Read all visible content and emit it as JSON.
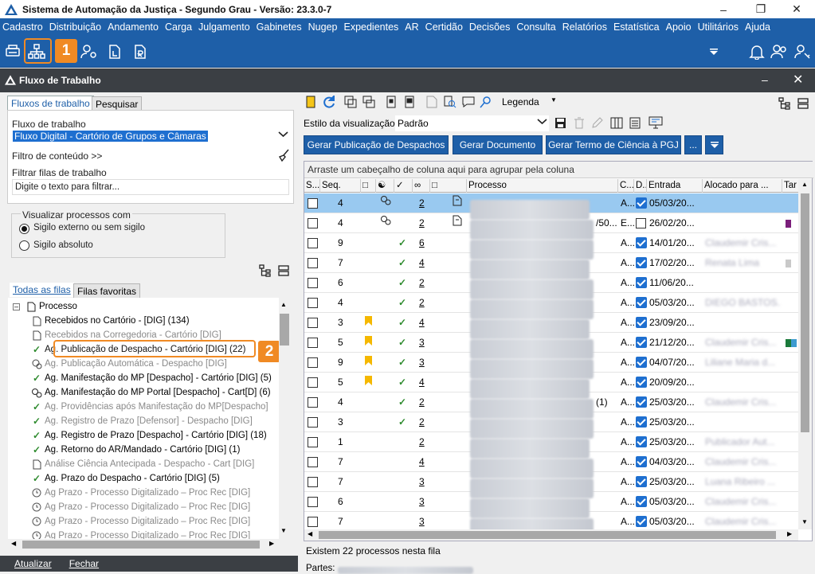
{
  "window": {
    "title": "Sistema de Automação da Justiça - Segundo Grau - Versão: 23.3.0-7"
  },
  "menu": [
    "Cadastro",
    "Distribuição",
    "Andamento",
    "Carga",
    "Julgamento",
    "Gabinetes",
    "Nugep",
    "Expedientes",
    "AR",
    "Certidão",
    "Decisões",
    "Consulta",
    "Relatórios",
    "Estatística",
    "Apoio",
    "Utilitários",
    "Ajuda"
  ],
  "callouts": {
    "one": "1",
    "two": "2"
  },
  "panel": {
    "title": "Fluxo de Trabalho"
  },
  "left": {
    "tabs": [
      "Fluxos de trabalho",
      "Pesquisar"
    ],
    "flow_label": "Fluxo de trabalho",
    "flow_value": "Fluxo Digital - Cartório de Grupos e Câmaras",
    "content_filter": "Filtro de conteúdo >>",
    "queue_filter_label": "Filtrar filas de trabalho",
    "queue_filter_placeholder": "Digite o texto para filtrar...",
    "visualize_label": "Visualizar processos com",
    "radio_external": "Sigilo externo ou sem sigilo",
    "radio_absolute": "Sigilo absoluto",
    "queue_tabs": [
      "Todas as filas",
      "Filas favoritas"
    ],
    "tree_root": "Processo",
    "tree": [
      {
        "label": "Recebidos no Cartório - [DIG] (134)",
        "icon": "doc",
        "dis": false
      },
      {
        "label": "Recebidos na Corregedoria - Cartório [DIG]",
        "icon": "doc",
        "dis": true
      },
      {
        "label": "Ag. Publicação de Despacho - Cartório [DIG] (22)",
        "icon": "check",
        "dis": false
      },
      {
        "label": "Ag. Publicação Automática - Despacho [DIG]",
        "icon": "coin",
        "dis": true
      },
      {
        "label": "Ag. Manifestação do MP [Despacho] - Cartório [DIG] (5)",
        "icon": "check",
        "dis": false
      },
      {
        "label": "Ag. Manifestação do MP Portal [Despacho] - Cart[D] (6)",
        "icon": "gear",
        "dis": false
      },
      {
        "label": "Ag. Providências após Manifestação do MP[Despacho]",
        "icon": "check",
        "dis": true
      },
      {
        "label": "Ag. Registro de Prazo [Defensor] - Despacho [DIG]",
        "icon": "check",
        "dis": true
      },
      {
        "label": "Ag. Registro de Prazo [Despacho] - Cartório [DIG] (18)",
        "icon": "check",
        "dis": false
      },
      {
        "label": "Ag. Retorno do AR/Mandado - Cartório [DIG] (1)",
        "icon": "check",
        "dis": false
      },
      {
        "label": "Análise Ciência Antecipada - Despacho - Cart [DIG]",
        "icon": "doc",
        "dis": true
      },
      {
        "label": "Ag. Prazo do Despacho - Cartório [DIG] (5)",
        "icon": "check",
        "dis": false
      },
      {
        "label": "Ag Prazo - Processo Digitalizado – Proc Rec [DIG]",
        "icon": "clock",
        "dis": true
      },
      {
        "label": "Ag Prazo - Processo Digitalizado – Proc Rec [DIG]",
        "icon": "clock",
        "dis": true
      },
      {
        "label": "Ag Prazo - Processo Digitalizado – Proc Rec [DIG]",
        "icon": "clock",
        "dis": true
      },
      {
        "label": "Ag Prazo - Processo Digitalizado – Proc Rec [DIG]",
        "icon": "clock",
        "dis": true
      }
    ],
    "bottom": [
      "Atualizar",
      "Fechar"
    ]
  },
  "right": {
    "legend": "Legenda",
    "view_style_label": "Estilo da visualização",
    "view_style_value": "Padrão",
    "buttons": [
      "Gerar Publicação de Despachos",
      "Gerar Documento",
      "Gerar Termo de Ciência à PGJ",
      "..."
    ],
    "group_hint": "Arraste um cabeçalho de coluna aqui para agrupar pela coluna",
    "columns": [
      "S...",
      "Seq.",
      "Processo",
      "C...",
      "D...",
      "Entrada",
      "Alocado para ...",
      "Tar"
    ],
    "rows": [
      {
        "seq": "4",
        "flag": false,
        "check": false,
        "num": "2",
        "c": "A...",
        "d": true,
        "date": "05/03/20...",
        "alloc": "",
        "sel": true,
        "extra": "",
        "icon2": true
      },
      {
        "seq": "4",
        "flag": false,
        "check": false,
        "num": "2",
        "c": "E...",
        "d": false,
        "date": "26/02/20...",
        "alloc": "",
        "sel": false,
        "extra": "/50...",
        "icon2": true
      },
      {
        "seq": "9",
        "flag": false,
        "check": true,
        "num": "6",
        "c": "A...",
        "d": true,
        "date": "14/01/20...",
        "alloc": "Claudemir Cris...",
        "sel": false,
        "extra": "",
        "icon2": false
      },
      {
        "seq": "7",
        "flag": false,
        "check": true,
        "num": "4",
        "c": "A...",
        "d": true,
        "date": "17/02/20...",
        "alloc": "Renata Lima",
        "sel": false,
        "extra": "",
        "icon2": false
      },
      {
        "seq": "6",
        "flag": false,
        "check": true,
        "num": "2",
        "c": "A...",
        "d": true,
        "date": "11/06/20...",
        "alloc": "",
        "sel": false,
        "extra": "",
        "icon2": false
      },
      {
        "seq": "4",
        "flag": false,
        "check": true,
        "num": "2",
        "c": "A...",
        "d": true,
        "date": "05/03/20...",
        "alloc": "DIEGO BASTOS...",
        "sel": false,
        "extra": "",
        "icon2": false
      },
      {
        "seq": "3",
        "flag": true,
        "check": true,
        "num": "4",
        "c": "A...",
        "d": true,
        "date": "23/09/20...",
        "alloc": "",
        "sel": false,
        "extra": "",
        "icon2": false
      },
      {
        "seq": "5",
        "flag": true,
        "check": true,
        "num": "3",
        "c": "A...",
        "d": true,
        "date": "21/12/20...",
        "alloc": "Claudemir Cris...",
        "sel": false,
        "extra": "",
        "icon2": false
      },
      {
        "seq": "9",
        "flag": true,
        "check": true,
        "num": "3",
        "c": "A...",
        "d": true,
        "date": "04/07/20...",
        "alloc": "Liliane Maria d...",
        "sel": false,
        "extra": "",
        "icon2": false
      },
      {
        "seq": "5",
        "flag": true,
        "check": true,
        "num": "4",
        "c": "A...",
        "d": true,
        "date": "20/09/20...",
        "alloc": "",
        "sel": false,
        "extra": "",
        "icon2": false
      },
      {
        "seq": "4",
        "flag": false,
        "check": true,
        "num": "2",
        "c": "A...",
        "d": true,
        "date": "25/03/20...",
        "alloc": "Claudemir Cris...",
        "sel": false,
        "extra": "(1)",
        "icon2": false
      },
      {
        "seq": "3",
        "flag": false,
        "check": true,
        "num": "2",
        "c": "A...",
        "d": true,
        "date": "25/03/20...",
        "alloc": "",
        "sel": false,
        "extra": "",
        "icon2": false
      },
      {
        "seq": "1",
        "flag": false,
        "check": false,
        "num": "2",
        "c": "A...",
        "d": true,
        "date": "25/03/20...",
        "alloc": "Publicador Aut...",
        "sel": false,
        "extra": "",
        "icon2": false
      },
      {
        "seq": "7",
        "flag": false,
        "check": false,
        "num": "4",
        "c": "A...",
        "d": true,
        "date": "04/03/20...",
        "alloc": "Claudemir Cris...",
        "sel": false,
        "extra": "",
        "icon2": false
      },
      {
        "seq": "7",
        "flag": false,
        "check": false,
        "num": "3",
        "c": "A...",
        "d": true,
        "date": "25/03/20...",
        "alloc": "Luana Ribeiro ...",
        "sel": false,
        "extra": "",
        "icon2": false
      },
      {
        "seq": "6",
        "flag": false,
        "check": false,
        "num": "3",
        "c": "A...",
        "d": true,
        "date": "05/03/20...",
        "alloc": "Claudemir Cris...",
        "sel": false,
        "extra": "",
        "icon2": false
      },
      {
        "seq": "7",
        "flag": false,
        "check": false,
        "num": "3",
        "c": "A...",
        "d": true,
        "date": "05/03/20...",
        "alloc": "Claudemir Cris...",
        "sel": false,
        "extra": "",
        "icon2": false
      }
    ],
    "status": "Existem 22 processos nesta fila",
    "parts_label": "Partes:"
  },
  "colors": {
    "brand": "#1e5fa8",
    "callout": "#f08a24",
    "selected_row": "#99c9f0"
  }
}
